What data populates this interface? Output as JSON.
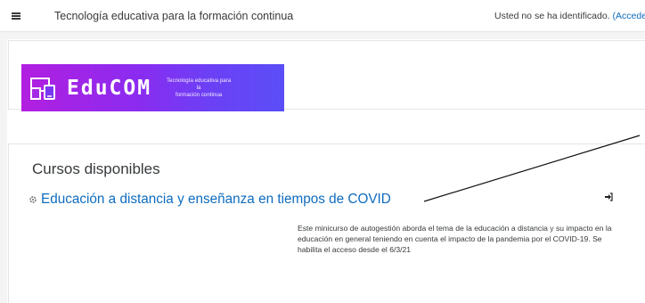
{
  "navbar": {
    "menu_icon": "hamburger-icon",
    "site_title": "Tecnología educativa para la formación continua",
    "login_text": "Usted no se ha identificado. ",
    "login_link": "(Accede"
  },
  "logo": {
    "icon": "devices-icon",
    "wordmark": "EduCOM",
    "tagline_line1": "Tecnología educativa  para la",
    "tagline_line2": "formación continua",
    "colors": {
      "gradient_start": "#b21fe0",
      "gradient_end": "#5a4ef7"
    }
  },
  "courses": {
    "heading": "Cursos disponibles",
    "items": [
      {
        "icon": "course-icon",
        "title": "Educación a distancia y enseñanza en tiempos de COVID",
        "enrol_icon": "login-icon",
        "summary": "Este minicurso de autogestión aborda el tema de la educación a distancia y su impacto en la educación en general teniendo en cuenta el impacto de la pandemia por el COVID-19. Se habilita el acceso desde el 6/3/21"
      }
    ]
  },
  "colors": {
    "link": "#0f6cbf",
    "text": "#373a3c",
    "page_bg": "#f4f4f4"
  }
}
